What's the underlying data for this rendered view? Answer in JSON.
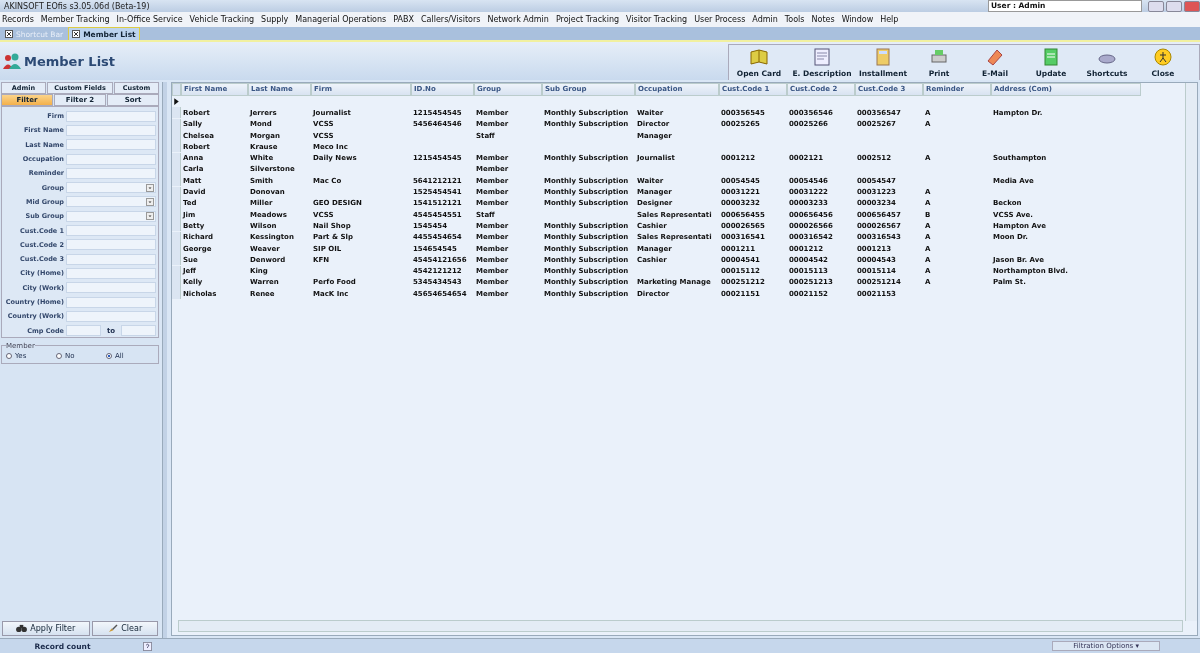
{
  "window": {
    "title": "AKINSOFT EOfis s3.05.06d (Beta-19)",
    "user": "User : Admin"
  },
  "menu": [
    "Records",
    "Member Tracking",
    "In-Office Service",
    "Vehicle Tracking",
    "Supply",
    "Managerial Operations",
    "PABX",
    "Callers/Visitors",
    "Network Admin",
    "Project Tracking",
    "Visitor Tracking",
    "User Process",
    "Admin",
    "Tools",
    "Notes",
    "Window",
    "Help"
  ],
  "doc_tabs": [
    {
      "label": "Shortcut Bar",
      "selected": false
    },
    {
      "label": "Member List",
      "selected": true
    }
  ],
  "page_title": "Member List",
  "toolbar": [
    "Open Card",
    "E. Description",
    "Installment",
    "Print",
    "E-Mail",
    "Update",
    "Shortcuts",
    "Close"
  ],
  "filter_tabs": [
    [
      {
        "label": "Admin",
        "selected": false
      },
      {
        "label": "Custom Fields",
        "selected": false
      },
      {
        "label": "Custom",
        "selected": false
      }
    ],
    [
      {
        "label": "Filter",
        "selected": true
      },
      {
        "label": "Filter 2",
        "selected": false
      },
      {
        "label": "Sort",
        "selected": false
      }
    ]
  ],
  "filter_fields": [
    {
      "label": "Firm",
      "kind": "text"
    },
    {
      "label": "First Name",
      "kind": "text"
    },
    {
      "label": "Last Name",
      "kind": "text"
    },
    {
      "label": "Occupation",
      "kind": "text"
    },
    {
      "label": "Reminder",
      "kind": "text"
    },
    {
      "label": "Group",
      "kind": "dropdown"
    },
    {
      "label": "Mid Group",
      "kind": "dropdown"
    },
    {
      "label": "Sub Group",
      "kind": "dropdown"
    },
    {
      "label": "Cust.Code 1",
      "kind": "text"
    },
    {
      "label": "Cust.Code 2",
      "kind": "text"
    },
    {
      "label": "Cust.Code 3",
      "kind": "text"
    },
    {
      "label": "City (Home)",
      "kind": "text"
    },
    {
      "label": "City (Work)",
      "kind": "text"
    },
    {
      "label": "Country (Home)",
      "kind": "text"
    },
    {
      "label": "Country (Work)",
      "kind": "text"
    },
    {
      "label": "Cmp Code",
      "kind": "range",
      "separator": "to"
    }
  ],
  "member": {
    "legend": "Member",
    "options": [
      {
        "label": "Yes",
        "selected": false
      },
      {
        "label": "No",
        "selected": false
      },
      {
        "label": "All",
        "selected": true
      }
    ]
  },
  "buttons": [
    "Apply Filter",
    "Clear"
  ],
  "table": {
    "columns": [
      "First Name",
      "Last Name",
      "Firm",
      "ID.No",
      "Group",
      "Sub Group",
      "Occupation",
      "Cust.Code 1",
      "Cust.Code 2",
      "Cust.Code 3",
      "Reminder",
      "Address (Com)"
    ],
    "rows": [
      [
        "Robert",
        "Jerrers",
        "Journalist",
        "1215454545",
        "Member",
        "Monthly Subscription",
        "Waiter",
        "000356545",
        "000356546",
        "000356547",
        "A",
        "Hampton Dr."
      ],
      [
        "Sally",
        "Mond",
        "VCSS",
        "5456464546",
        "Member",
        "Monthly Subscription",
        "Director",
        "00025265",
        "00025266",
        "00025267",
        "A",
        ""
      ],
      [
        "Chelsea",
        "Morgan",
        "VCSS",
        "",
        "Staff",
        "",
        "Manager",
        "",
        "",
        "",
        "",
        ""
      ],
      [
        "Robert",
        "Krause",
        "Meco Inc",
        "",
        "",
        "",
        "",
        "",
        "",
        "",
        "",
        ""
      ],
      [
        "Anna",
        "White",
        "Daily News",
        "1215454545",
        "Member",
        "Monthly Subscription",
        "Journalist",
        "0001212",
        "0002121",
        "0002512",
        "A",
        "Southampton"
      ],
      [
        "Carla",
        "Silverstone",
        "",
        "",
        "Member",
        "",
        "",
        "",
        "",
        "",
        "",
        ""
      ],
      [
        "Matt",
        "Smith",
        "Mac Co",
        "5641212121",
        "Member",
        "Monthly Subscription",
        "Waiter",
        "00054545",
        "00054546",
        "00054547",
        "",
        "Media Ave"
      ],
      [
        "David",
        "Donovan",
        "",
        "1525454541",
        "Member",
        "Monthly Subscription",
        "Manager",
        "00031221",
        "00031222",
        "00031223",
        "A",
        ""
      ],
      [
        "Ted",
        "Miller",
        "GEO DESIGN",
        "1541512121",
        "Member",
        "Monthly Subscription",
        "Designer",
        "00003232",
        "00003233",
        "00003234",
        "A",
        "Beckon"
      ],
      [
        "Jim",
        "Meadows",
        "VCSS",
        "4545454551",
        "Staff",
        "",
        "Sales Representati",
        "000656455",
        "000656456",
        "000656457",
        "B",
        "VCSS Ave."
      ],
      [
        "Betty",
        "Wilson",
        "Nail Shop",
        "1545454",
        "Member",
        "Monthly Subscription",
        "Cashier",
        "000026565",
        "000026566",
        "000026567",
        "A",
        "Hampton Ave"
      ],
      [
        "Richard",
        "Kessington",
        "Part & Slp",
        "4455454654",
        "Member",
        "Monthly Subscription",
        "Sales Representati",
        "000316541",
        "000316542",
        "000316543",
        "A",
        "Moon Dr."
      ],
      [
        "George",
        "Weaver",
        "SIP OIL",
        "154654545",
        "Member",
        "Monthly Subscription",
        "Manager",
        "0001211",
        "0001212",
        "0001213",
        "A",
        ""
      ],
      [
        "Sue",
        "Denword",
        "KFN",
        "45454121656",
        "Member",
        "Monthly Subscription",
        "Cashier",
        "00004541",
        "00004542",
        "00004543",
        "A",
        "Jason Br. Ave"
      ],
      [
        "Jeff",
        "King",
        "",
        "4542121212",
        "Member",
        "Monthly Subscription",
        "",
        "00015112",
        "00015113",
        "00015114",
        "A",
        "Northampton Blvd."
      ],
      [
        "Kelly",
        "Warren",
        "Perfo Food",
        "5345434543",
        "Member",
        "Monthly Subscription",
        "Marketing Manage",
        "000251212",
        "000251213",
        "000251214",
        "A",
        "Palm St."
      ],
      [
        "Nicholas",
        "Renee",
        "MacK Inc",
        "45654654654",
        "Member",
        "Monthly Subscription",
        "Director",
        "00021151",
        "00021152",
        "00021153",
        "",
        ""
      ]
    ]
  },
  "status_bar": {
    "record_count": "Record count",
    "options": "Filtration Options ▾"
  }
}
